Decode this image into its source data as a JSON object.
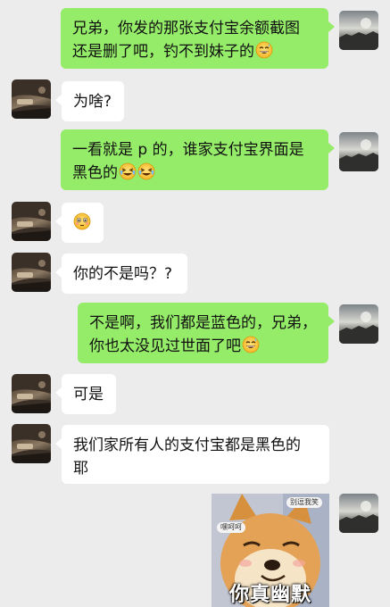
{
  "chat": {
    "messages": [
      {
        "side": "right",
        "lines": [
          "兄弟，你发的那张支付宝余额截图",
          "还是删了吧，钓不到妹子的"
        ],
        "emoji": [
          "grin-sweat"
        ]
      },
      {
        "side": "left",
        "lines": [
          "为啥?"
        ]
      },
      {
        "side": "right",
        "lines": [
          "一看就是 p 的，谁家支付宝界面是",
          "黑色的"
        ],
        "emoji": [
          "laugh-cry",
          "laugh-cry"
        ]
      },
      {
        "side": "left",
        "lines": [],
        "emoji": [
          "flushed"
        ]
      },
      {
        "side": "left",
        "lines": [
          "你的不是吗？?"
        ]
      },
      {
        "side": "right",
        "lines": [
          "不是啊，我们都是蓝色的，兄弟，",
          "你也太没见过世面了吧"
        ],
        "emoji": [
          "grin-sweat"
        ]
      },
      {
        "side": "left",
        "lines": [
          "可是"
        ]
      },
      {
        "side": "left",
        "lines": [
          "我们家所有人的支付宝都是黑色的",
          "耶"
        ]
      }
    ],
    "sticker": {
      "caption": "你真幽默",
      "tag_left": "嘿呵呵",
      "tag_right": "别逗我笑"
    }
  },
  "colors": {
    "background": "#ececec",
    "sent_bubble": "#95ec69",
    "received_bubble": "#ffffff"
  }
}
